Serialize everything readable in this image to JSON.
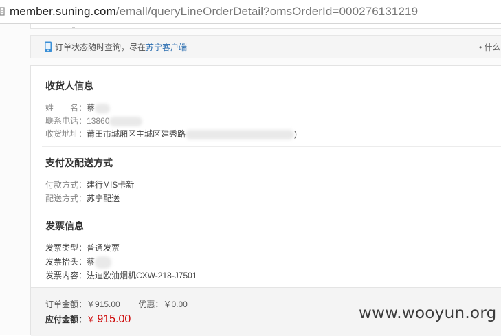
{
  "browser": {
    "url_host": "member.suning.com",
    "url_path": "/emall/queryLineOrderDetail?omsOrderId=000276131219"
  },
  "notice": {
    "text": "订单状态随时查询，尽在",
    "link": "苏宁客户端",
    "right": "• 什么"
  },
  "consignee": {
    "title": "收货人信息",
    "name_label": "姓　　名：",
    "name_value": "蔡",
    "phone_label": "联系电话：",
    "phone_value": "13860",
    "address_label": "收货地址：",
    "address_value": "莆田市城厢区主城区建秀路",
    "address_tail": ")"
  },
  "payment": {
    "title": "支付及配送方式",
    "pay_label": "付款方式：",
    "pay_value": "建行MIS卡新",
    "delivery_label": "配送方式：",
    "delivery_value": "苏宁配送"
  },
  "invoice": {
    "title": "发票信息",
    "type_label": "发票类型：",
    "type_value": "普通发票",
    "header_label": "发票抬头：",
    "header_value": "蔡",
    "content_label": "发票内容：",
    "content_value": "法迪欧油烟机CXW-218-J7501"
  },
  "totals": {
    "order_label": "订单金额：",
    "order_value": "￥915.00",
    "discount_label": "优惠：",
    "discount_value": "￥0.00",
    "payable_label": "应付金额：",
    "payable_currency": "￥",
    "payable_value": "915.00"
  },
  "watermark": "www.wooyun.org"
}
